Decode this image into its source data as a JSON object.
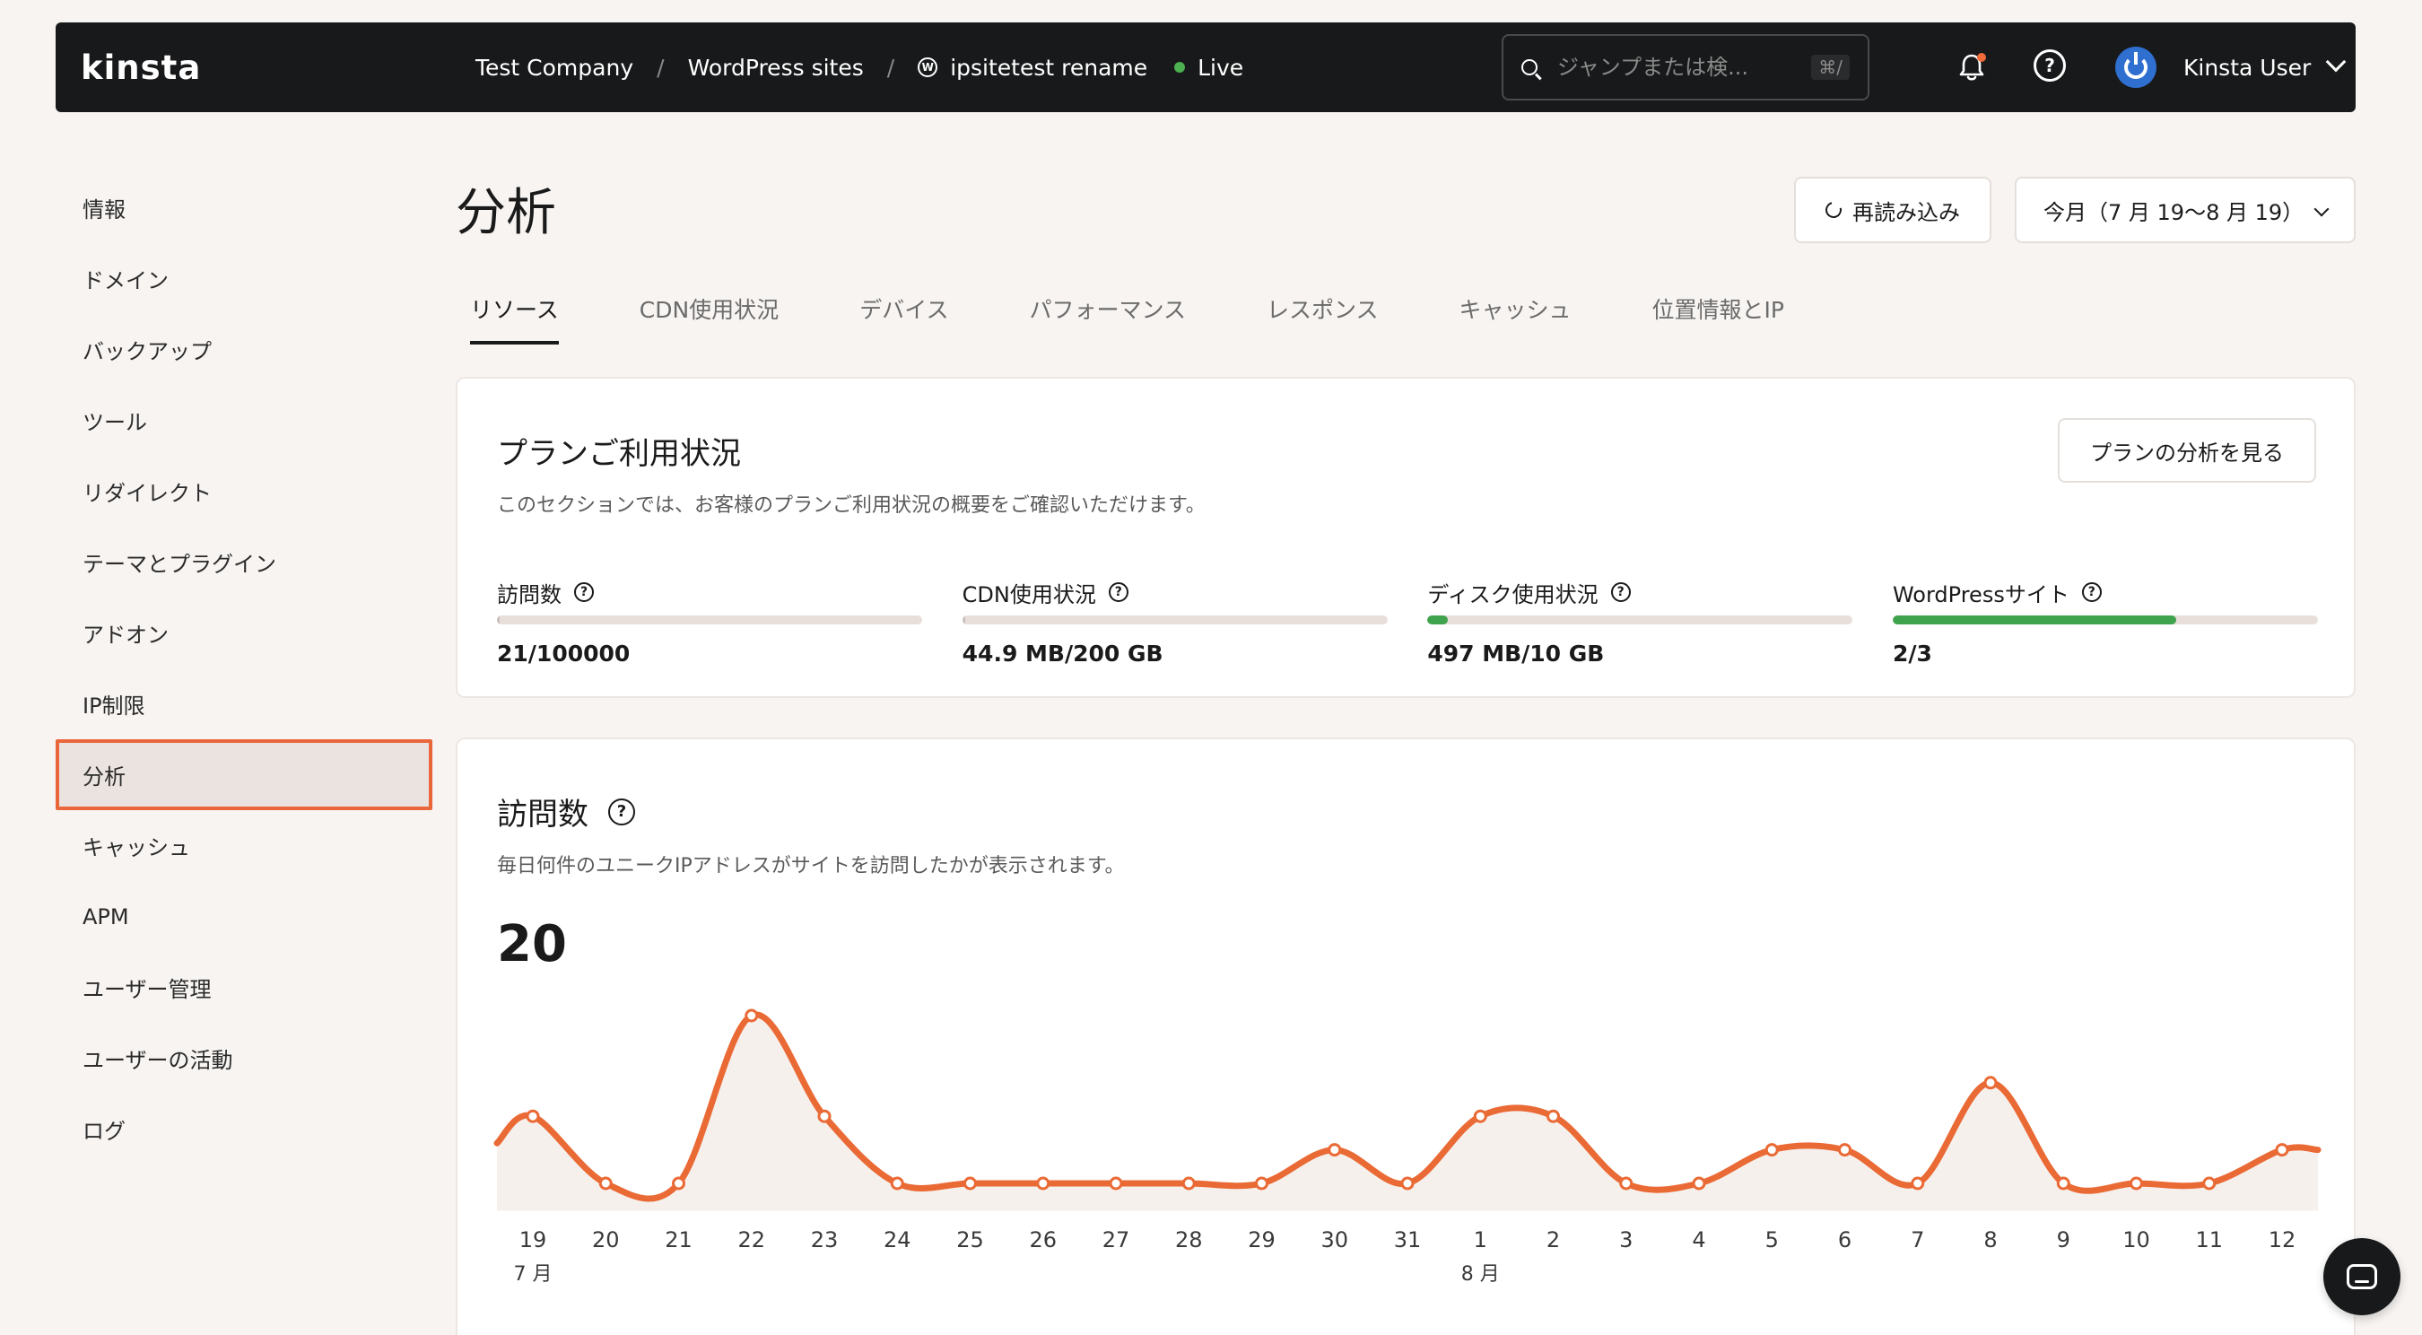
{
  "topbar": {
    "logo": "kinsta",
    "breadcrumbs": [
      "Test Company",
      "WordPress sites",
      "ipsitetest rename"
    ],
    "separator": "/",
    "status": "Live",
    "search_placeholder": "ジャンプまたは検...",
    "search_shortcut": "⌘/",
    "user_name": "Kinsta User",
    "colors": {
      "bar": "#18191a",
      "live": "#4caf50",
      "notification": "#f26b3a",
      "avatar": "#2f6fcf"
    }
  },
  "sidebar": {
    "items": [
      {
        "label": "情報"
      },
      {
        "label": "ドメイン"
      },
      {
        "label": "バックアップ"
      },
      {
        "label": "ツール"
      },
      {
        "label": "リダイレクト"
      },
      {
        "label": "テーマとプラグイン"
      },
      {
        "label": "アドオン"
      },
      {
        "label": "IP制限"
      },
      {
        "label": "分析",
        "active": true
      },
      {
        "label": "キャッシュ"
      },
      {
        "label": "APM"
      },
      {
        "label": "ユーザー管理"
      },
      {
        "label": "ユーザーの活動"
      },
      {
        "label": "ログ"
      }
    ]
  },
  "page": {
    "title": "分析",
    "reload_label": "再読み込み",
    "date_range": "今月（7 月 19〜8 月 19）"
  },
  "tabs": [
    {
      "label": "リソース",
      "active": true
    },
    {
      "label": "CDN使用状況"
    },
    {
      "label": "デバイス"
    },
    {
      "label": "パフォーマンス"
    },
    {
      "label": "レスポンス"
    },
    {
      "label": "キャッシュ"
    },
    {
      "label": "位置情報とIP"
    }
  ],
  "plan_usage": {
    "title": "プランご利用状況",
    "description": "このセクションでは、お客様のプランご利用状況の概要をご確認いただけます。",
    "button": "プランの分析を見る",
    "metrics": [
      {
        "label": "訪問数",
        "value": "21/100000",
        "fraction": 0.0002
      },
      {
        "label": "CDN使用状況",
        "value": "44.9 MB/200 GB",
        "fraction": 0.0002
      },
      {
        "label": "ディスク使用状況",
        "value": "497 MB/10 GB",
        "fraction": 0.0485
      },
      {
        "label": "WordPressサイト",
        "value": "2/3",
        "fraction": 0.6667
      }
    ]
  },
  "visits": {
    "title": "訪問数",
    "description": "毎日何件のユニークIPアドレスがサイトを訪問したかが表示されます。",
    "total": "20"
  },
  "chart_data": {
    "type": "line",
    "title": "",
    "xlabel": "",
    "ylabel": "",
    "x": [
      "19",
      "20",
      "21",
      "22",
      "23",
      "24",
      "25",
      "26",
      "27",
      "28",
      "29",
      "30",
      "31",
      "1",
      "2",
      "3",
      "4",
      "5",
      "6",
      "7",
      "8",
      "9",
      "10",
      "11",
      "12"
    ],
    "month_labels": [
      {
        "index": 0,
        "label": "7 月"
      },
      {
        "index": 13,
        "label": "8 月"
      }
    ],
    "series": [
      {
        "values": [
          2,
          0,
          0,
          5,
          2,
          0,
          0,
          0,
          0,
          0,
          0,
          1,
          0,
          2,
          2,
          0,
          0,
          1,
          1,
          0,
          3,
          0,
          0,
          0,
          1
        ]
      }
    ],
    "ylim": [
      0,
      5
    ],
    "grid": false,
    "colors": {
      "line": "#ea6a35",
      "fill": "#f6f0ed",
      "point": "#ffffff"
    }
  }
}
